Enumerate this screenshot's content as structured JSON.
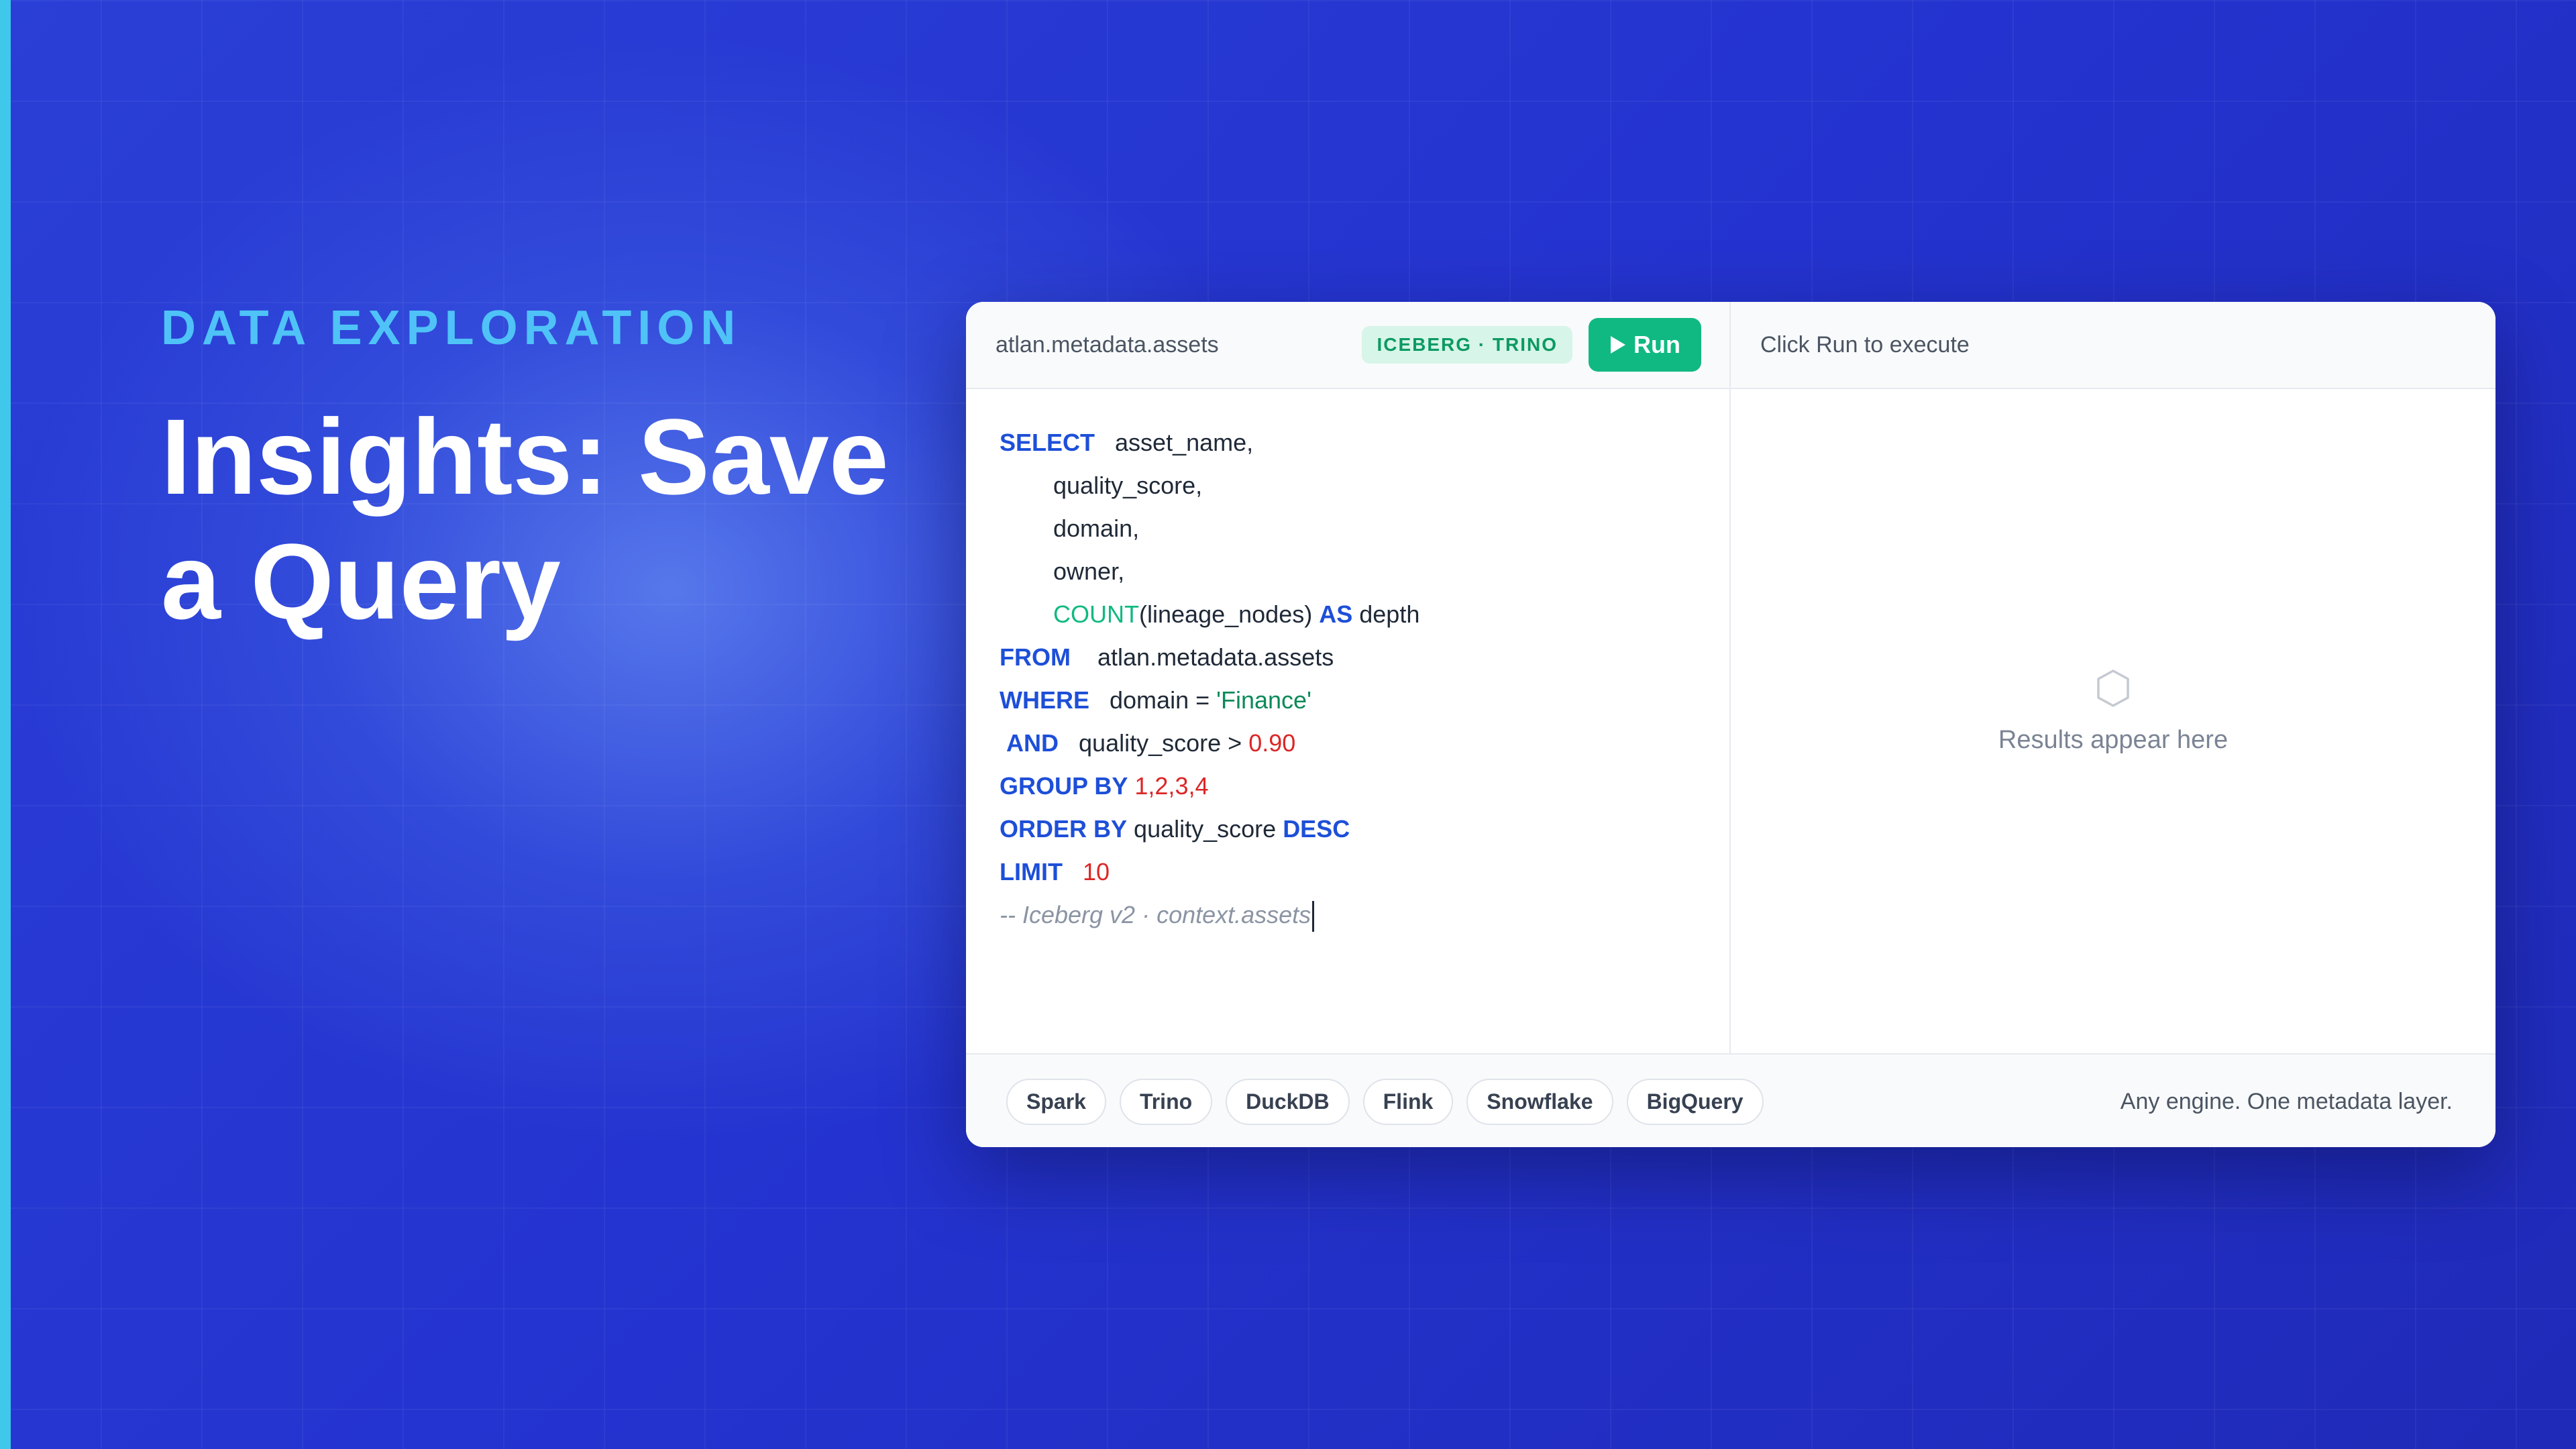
{
  "hero": {
    "eyebrow": "DATA EXPLORATION",
    "title_line1": "Insights: Save",
    "title_line2": "a Query"
  },
  "editor": {
    "table_name": "atlan.metadata.assets",
    "engine_badge": "ICEBERG · TRINO",
    "run_label": "Run",
    "sql": {
      "select_kw": "SELECT",
      "col1": "asset_name,",
      "col2": "quality_score,",
      "col3": "domain,",
      "col4": "owner,",
      "count_fn": "COUNT",
      "count_arg": "(lineage_nodes)",
      "as_kw": "AS",
      "alias": "depth",
      "from_kw": "FROM",
      "from_table": "atlan.metadata.assets",
      "where_kw": "WHERE",
      "where_lhs": "domain = ",
      "where_val": "'Finance'",
      "and_kw": "AND",
      "and_lhs": "quality_score > ",
      "and_val": "0.90",
      "group_kw": "GROUP BY",
      "group_val": "1,2,3,4",
      "order_kw": "ORDER BY",
      "order_col": "quality_score",
      "desc_kw": "DESC",
      "limit_kw": "LIMIT",
      "limit_val": "10",
      "comment": "-- Iceberg v2 · context.assets"
    }
  },
  "results": {
    "header": "Click Run to execute",
    "empty_text": "Results appear here",
    "empty_icon": "hexagon-icon"
  },
  "footer": {
    "engines": [
      "Spark",
      "Trino",
      "DuckDB",
      "Flink",
      "Snowflake",
      "BigQuery"
    ],
    "tagline": "Any engine. One metadata layer."
  },
  "colors": {
    "background": "#2433cf",
    "accent_cyan": "#4fc3f7",
    "keyword_blue": "#1d4fd8",
    "run_green": "#10b981",
    "number_red": "#dc2626"
  }
}
